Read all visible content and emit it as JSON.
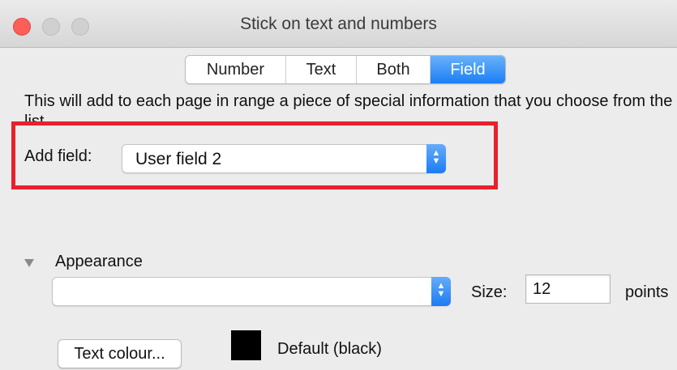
{
  "window": {
    "title": "Stick on text and numbers"
  },
  "tabs": [
    {
      "label": "Number",
      "selected": false
    },
    {
      "label": "Text",
      "selected": false
    },
    {
      "label": "Both",
      "selected": false
    },
    {
      "label": "Field",
      "selected": true
    }
  ],
  "description": "This will add to each page in range a piece of special information that you choose from the list",
  "add_field": {
    "label": "Add field:",
    "selected_value": "User field 2"
  },
  "appearance": {
    "label": "Appearance",
    "font_popup_value": "",
    "size_label": "Size:",
    "size_value": "12",
    "size_unit": "points",
    "text_colour_button": "Text colour...",
    "colour_swatch": "#000000",
    "colour_name": "Default (black)"
  },
  "colors": {
    "accent": "#1b7ef5",
    "highlight_box": "#e8212c"
  }
}
